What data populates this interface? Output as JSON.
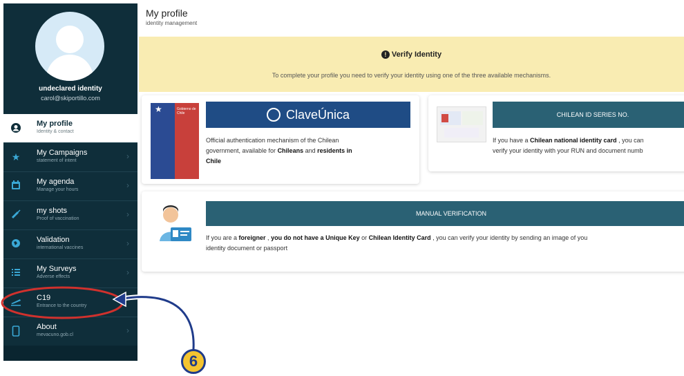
{
  "header": {
    "title": "My profile",
    "subtitle": "identity management"
  },
  "user": {
    "name": "undeclared identity",
    "email": "carol@skiportillo.com"
  },
  "nav": [
    {
      "label": "My profile",
      "sub": "Identity & contact",
      "icon": "user-icon",
      "active": true
    },
    {
      "label": "My Campaigns",
      "sub": "statement of intent",
      "icon": "star-icon",
      "active": false
    },
    {
      "label": "My agenda",
      "sub": "Manage your hours",
      "icon": "calendar-icon",
      "active": false
    },
    {
      "label": "my shots",
      "sub": "Proof of vaccination",
      "icon": "syringe-icon",
      "active": false
    },
    {
      "label": "Validation",
      "sub": "international vaccines",
      "icon": "globe-icon",
      "active": false
    },
    {
      "label": "My Surveys",
      "sub": "Adverse effects",
      "icon": "list-icon",
      "active": false
    },
    {
      "label": "C19",
      "sub": "Entrance to the country",
      "icon": "plane-icon",
      "active": false
    },
    {
      "label": "About",
      "sub": "mevacuno.gob.cl",
      "icon": "phone-icon",
      "active": false
    }
  ],
  "banner": {
    "icon": "!",
    "title": "Verify Identity",
    "text": "To complete your profile you need to verify your identity using one of the three available mechanisms."
  },
  "clave": {
    "logo_text": "ClaveÚnica",
    "flag_text": "Gobierno de Chile",
    "text_1": "Official authentication mechanism of the Chilean",
    "text_2a": "government, available for ",
    "text_2b": "Chileans",
    "text_2c": " and ",
    "text_2d": "residents in",
    "text_3": "Chile"
  },
  "chilean": {
    "header": "CHILEAN ID SERIES NO.",
    "text_1a": "If you have a ",
    "text_1b": "Chilean national identity card",
    "text_1c": " , you can",
    "text_2": "verify your identity with your RUN and document numb"
  },
  "manual": {
    "header": "MANUAL VERIFICATION",
    "text_1a": "If you are a ",
    "text_1b": "foreigner",
    "text_1c": " , ",
    "text_1d": "you do not have a Unique Key",
    "text_1e": " or ",
    "text_1f": "Chilean Identity Card",
    "text_1g": " , you can verify your identity by sending an image of you",
    "text_2": "identity document or passport"
  },
  "annotation": {
    "step": "6",
    "color_badge": "#f4c430",
    "color_arrow": "#1f3b8a",
    "color_ring": "#d0312d"
  },
  "colors": {
    "sidebar": "#0f2e3a",
    "banner": "#f9ecb2",
    "button": "#2a6174",
    "clave": "#1f4c85"
  }
}
